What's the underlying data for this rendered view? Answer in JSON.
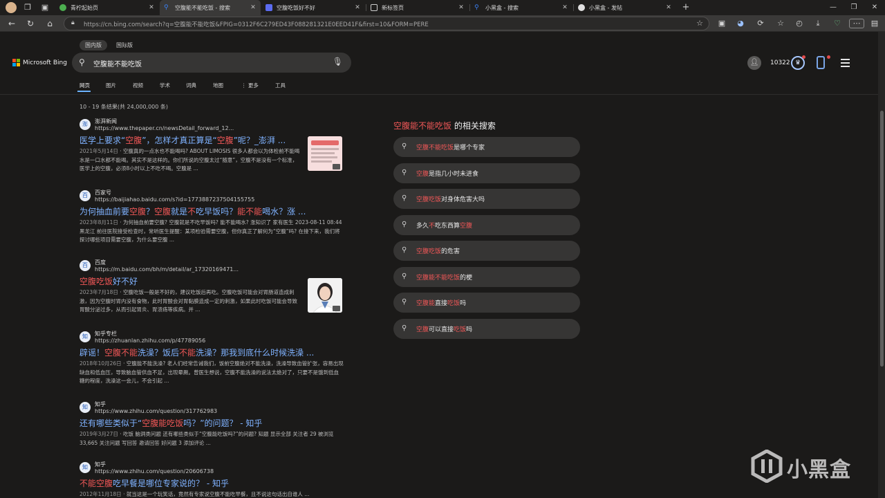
{
  "browser": {
    "tabs": [
      {
        "label": "青柠起始页",
        "favicon_color": "#4caf50",
        "active": false
      },
      {
        "label": "空腹能不能吃饭 - 搜索",
        "favicon_color": "#3b82f6",
        "active": true
      },
      {
        "label": "空腹吃饭好不好",
        "favicon_color": "#5b6bf0",
        "active": false
      },
      {
        "label": "新标签页",
        "favicon_color": "#cfcfcf",
        "active": false
      },
      {
        "label": "小黑盒 - 搜索",
        "favicon_color": "#3b82f6",
        "active": false
      },
      {
        "label": "小黑盒 - 发帖",
        "favicon_color": "#e0e0e0",
        "active": false
      }
    ],
    "new_tab": "+",
    "url": "https://cn.bing.com/search?q=空腹能不能吃饭&FPIG=0312F6C279ED43F088281321E0EED41F&first=10&FORM=PERE",
    "window_controls": [
      "—",
      "❐",
      "✕"
    ]
  },
  "bing": {
    "region_pills": [
      "国内版",
      "国际版"
    ],
    "logo_text": "Microsoft Bing",
    "query": "空腹能不能吃饭",
    "scopes": [
      "网页",
      "图片",
      "视频",
      "学术",
      "词典",
      "地图",
      "⋮ 更多",
      "工具"
    ],
    "points": "10322",
    "result_count": "10 - 19 条结果(共 24,000,000 条)"
  },
  "results": [
    {
      "site": "澎湃新闻",
      "url": "https://www.thepaper.cn/newsDetail_forward_12...",
      "icon": "澎",
      "title_parts": [
        {
          "t": "医学上要求“",
          "hl": false
        },
        {
          "t": "空腹",
          "hl": true
        },
        {
          "t": "”，怎样才真正算是“",
          "hl": false
        },
        {
          "t": "空腹",
          "hl": true
        },
        {
          "t": "”呢？_澎湃 ...",
          "hl": false
        }
      ],
      "date": "2021年5月14日",
      "snippet": " · 空腹真的一点水也不能喝吗? ABOUT LIMOSIS 很多人都会以为体检前不能喝水是一口水都不能喝。其实不是这样的。你们所说的空腹太过“随意”，空腹不是没有一个标准，医学上的空腹，必须8小时以上不吃不喝。空腹是 ..."
    },
    {
      "site": "百家号",
      "url": "https://baijiahao.baidu.com/s?id=1773887237504155755",
      "icon": "百",
      "title_parts": [
        {
          "t": "为何抽血前要",
          "hl": false
        },
        {
          "t": "空腹",
          "hl": true
        },
        {
          "t": "？",
          "hl": false
        },
        {
          "t": "空腹",
          "hl": true
        },
        {
          "t": "就是",
          "hl": false
        },
        {
          "t": "不",
          "hl": true
        },
        {
          "t": "吃早饭吗？",
          "hl": false
        },
        {
          "t": "能不能",
          "hl": true
        },
        {
          "t": "喝水？涨 ...",
          "hl": false
        }
      ],
      "date": "2023年8月11日",
      "snippet": " · 为何抽血前要空腹? 空腹就是不吃早饭吗? 能不能喝水? 涨知识了 家有医生 2023-08-11 08:44 黑龙江 前往医院接受检查时，常听医生提醒：某项检验需要空腹，但你真正了解何为“空腹”吗? 在接下来，我们将探讨哪些项目需要空腹，为什么要空腹 ..."
    },
    {
      "site": "百度",
      "url": "https://m.baidu.com/bh/m/detail/ar_17320169471...",
      "icon": "百",
      "title_parts": [
        {
          "t": "空腹吃饭",
          "hl": true
        },
        {
          "t": "好不好",
          "hl": false
        }
      ],
      "date": "2023年7月18日",
      "snippet": " · 空腹吃饭一般是不好的，建议吃饭后再吃。空腹吃饭可能会对胃肠道造成刺激，因为空腹时胃内没有食物，此时胃酸会对胃黏膜造成一定的刺激，如果此时吃饭可能会导致胃酸分泌过多，从而引起胃炎、胃溃疡等疾病。并 ..."
    },
    {
      "site": "知乎专栏",
      "url": "https://zhuanlan.zhihu.com/p/47789056",
      "icon": "知",
      "title_parts": [
        {
          "t": "辟谣！",
          "hl": false
        },
        {
          "t": "空腹不能",
          "hl": true
        },
        {
          "t": "洗澡？饭后",
          "hl": false
        },
        {
          "t": "不能",
          "hl": true
        },
        {
          "t": "洗澡？那我到底什么时候洗澡 ...",
          "hl": false
        }
      ],
      "date": "2018年10月26日",
      "snippet": " · 空腹能不能洗澡? 老人们经常告诫我们，饭前空腹绝对不能洗澡，洗澡导致血管扩张，容易出现缺血和低血压，导致脑血管供血不足，出现晕厥。曾医生想说，空腹不能洗澡的说法太绝对了，只要不是饿到低血糖的程度，洗澡这一会儿，不会引起 ..."
    },
    {
      "site": "知乎",
      "url": "https://www.zhihu.com/question/317762983",
      "icon": "知",
      "title_parts": [
        {
          "t": "还有哪些类似于“",
          "hl": false
        },
        {
          "t": "空腹能吃饭",
          "hl": true
        },
        {
          "t": "吗？”的问题？ - 知乎",
          "hl": false
        }
      ],
      "date": "2019年3月27日",
      "snippet": " · 吃饭 脑洞类问题 还有哪些类似于“空腹能吃饭吗?”的问题? 知题 显示全部 关注者 29 被浏览 33,665 关注问题 写回答 邀请回答 好问题 3 添加评论 ..."
    },
    {
      "site": "知乎",
      "url": "https://www.zhihu.com/question/20606738",
      "icon": "知",
      "title_parts": [
        {
          "t": "不能空腹",
          "hl": true
        },
        {
          "t": "吃早餐是哪位专家说的？ - 知乎",
          "hl": false
        }
      ],
      "date": "2012年11月18日",
      "snippet": " · 就当这是一个玩笑话，竟然有专家说空腹不能吃早餐，且不说这句话出自谁人 ..."
    }
  ],
  "related": {
    "title_hl": "空腹能不能吃饭",
    "title_rest": " 的相关搜索",
    "items": [
      [
        {
          "t": "空腹不能吃饭",
          "hl": true
        },
        {
          "t": "是哪个专家",
          "hl": false
        }
      ],
      [
        {
          "t": "空腹",
          "hl": true
        },
        {
          "t": "是指几小时未进食",
          "hl": false
        }
      ],
      [
        {
          "t": "空腹吃饭",
          "hl": true
        },
        {
          "t": "对身体危害大吗",
          "hl": false
        }
      ],
      [
        {
          "t": "多久",
          "hl": false
        },
        {
          "t": "不",
          "hl": true
        },
        {
          "t": "吃东西算",
          "hl": false
        },
        {
          "t": "空腹",
          "hl": true
        }
      ],
      [
        {
          "t": "空腹吃饭",
          "hl": true
        },
        {
          "t": "的危害",
          "hl": false
        }
      ],
      [
        {
          "t": "空腹能不能吃饭",
          "hl": true
        },
        {
          "t": "的梗",
          "hl": false
        }
      ],
      [
        {
          "t": "空腹能",
          "hl": true
        },
        {
          "t": "直接",
          "hl": false
        },
        {
          "t": "吃饭",
          "hl": true
        },
        {
          "t": "吗",
          "hl": false
        }
      ],
      [
        {
          "t": "空腹",
          "hl": true
        },
        {
          "t": "可以直接",
          "hl": false
        },
        {
          "t": "吃饭",
          "hl": true
        },
        {
          "t": "吗",
          "hl": false
        }
      ]
    ]
  },
  "watermark": {
    "text": "小黑盒"
  },
  "colors": {
    "accent_link": "#7fb2ff",
    "highlight": "#f05757",
    "background": "#1b1a19"
  }
}
